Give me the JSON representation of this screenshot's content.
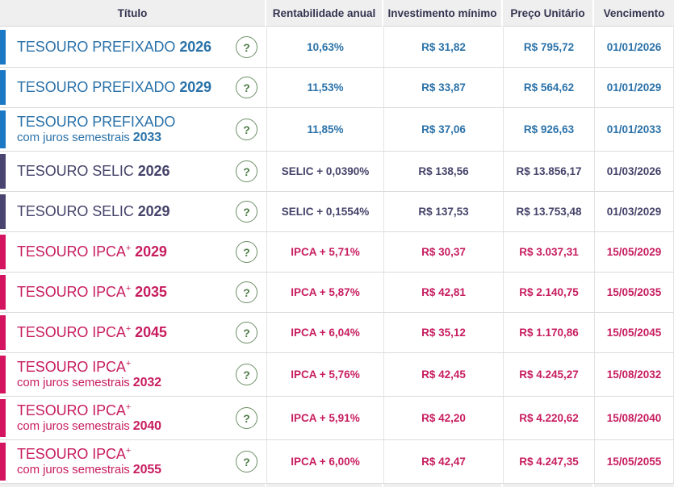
{
  "header": {
    "columns": [
      {
        "label": "Título"
      },
      {
        "label": "Rentabilidade anual"
      },
      {
        "label": "Investimento mínimo"
      },
      {
        "label": "Preço Unitário"
      },
      {
        "label": "Vencimento"
      }
    ]
  },
  "help_icon_glyph": "?",
  "colors": {
    "header_bg": "#efeff0",
    "header_text": "#343450",
    "row_border": "#dcdcdc",
    "help_green": "#4c7c46",
    "prefixado": {
      "bar": "#1b78c4",
      "text": "#2b72a9"
    },
    "selic": {
      "bar": "#4a4470",
      "text": "#45436a"
    },
    "ipca": {
      "bar": "#d4145f",
      "text": "#c71d5f"
    }
  },
  "rows": [
    {
      "category": "prefixado",
      "name": "TESOURO PREFIXADO",
      "sup": "",
      "line2": "",
      "year": "2026",
      "rate": "10,63%",
      "min_investment": "R$ 31,82",
      "unit_price": "R$ 795,72",
      "maturity": "01/01/2026"
    },
    {
      "category": "prefixado",
      "name": "TESOURO PREFIXADO",
      "sup": "",
      "line2": "",
      "year": "2029",
      "rate": "11,53%",
      "min_investment": "R$ 33,87",
      "unit_price": "R$ 564,62",
      "maturity": "01/01/2029"
    },
    {
      "category": "prefixado",
      "name": "TESOURO PREFIXADO",
      "sup": "",
      "line2": "com juros semestrais",
      "year": "2033",
      "rate": "11,85%",
      "min_investment": "R$ 37,06",
      "unit_price": "R$ 926,63",
      "maturity": "01/01/2033"
    },
    {
      "category": "selic",
      "name": "TESOURO SELIC",
      "sup": "",
      "line2": "",
      "year": "2026",
      "rate": "SELIC + 0,0390%",
      "min_investment": "R$ 138,56",
      "unit_price": "R$ 13.856,17",
      "maturity": "01/03/2026"
    },
    {
      "category": "selic",
      "name": "TESOURO SELIC",
      "sup": "",
      "line2": "",
      "year": "2029",
      "rate": "SELIC + 0,1554%",
      "min_investment": "R$ 137,53",
      "unit_price": "R$ 13.753,48",
      "maturity": "01/03/2029"
    },
    {
      "category": "ipca",
      "name": "TESOURO IPCA",
      "sup": "+",
      "line2": "",
      "year": "2029",
      "rate": "IPCA + 5,71%",
      "min_investment": "R$ 30,37",
      "unit_price": "R$ 3.037,31",
      "maturity": "15/05/2029"
    },
    {
      "category": "ipca",
      "name": "TESOURO IPCA",
      "sup": "+",
      "line2": "",
      "year": "2035",
      "rate": "IPCA + 5,87%",
      "min_investment": "R$ 42,81",
      "unit_price": "R$ 2.140,75",
      "maturity": "15/05/2035"
    },
    {
      "category": "ipca",
      "name": "TESOURO IPCA",
      "sup": "+",
      "line2": "",
      "year": "2045",
      "rate": "IPCA + 6,04%",
      "min_investment": "R$ 35,12",
      "unit_price": "R$ 1.170,86",
      "maturity": "15/05/2045"
    },
    {
      "category": "ipca",
      "name": "TESOURO IPCA",
      "sup": "+",
      "line2": "com juros semestrais",
      "year": "2032",
      "rate": "IPCA + 5,76%",
      "min_investment": "R$ 42,45",
      "unit_price": "R$ 4.245,27",
      "maturity": "15/08/2032"
    },
    {
      "category": "ipca",
      "name": "TESOURO IPCA",
      "sup": "+",
      "line2": "com juros semestrais",
      "year": "2040",
      "rate": "IPCA + 5,91%",
      "min_investment": "R$ 42,20",
      "unit_price": "R$ 4.220,62",
      "maturity": "15/08/2040"
    },
    {
      "category": "ipca",
      "name": "TESOURO IPCA",
      "sup": "+",
      "line2": "com juros semestrais",
      "year": "2055",
      "rate": "IPCA + 6,00%",
      "min_investment": "R$ 42,47",
      "unit_price": "R$ 4.247,35",
      "maturity": "15/05/2055"
    }
  ]
}
